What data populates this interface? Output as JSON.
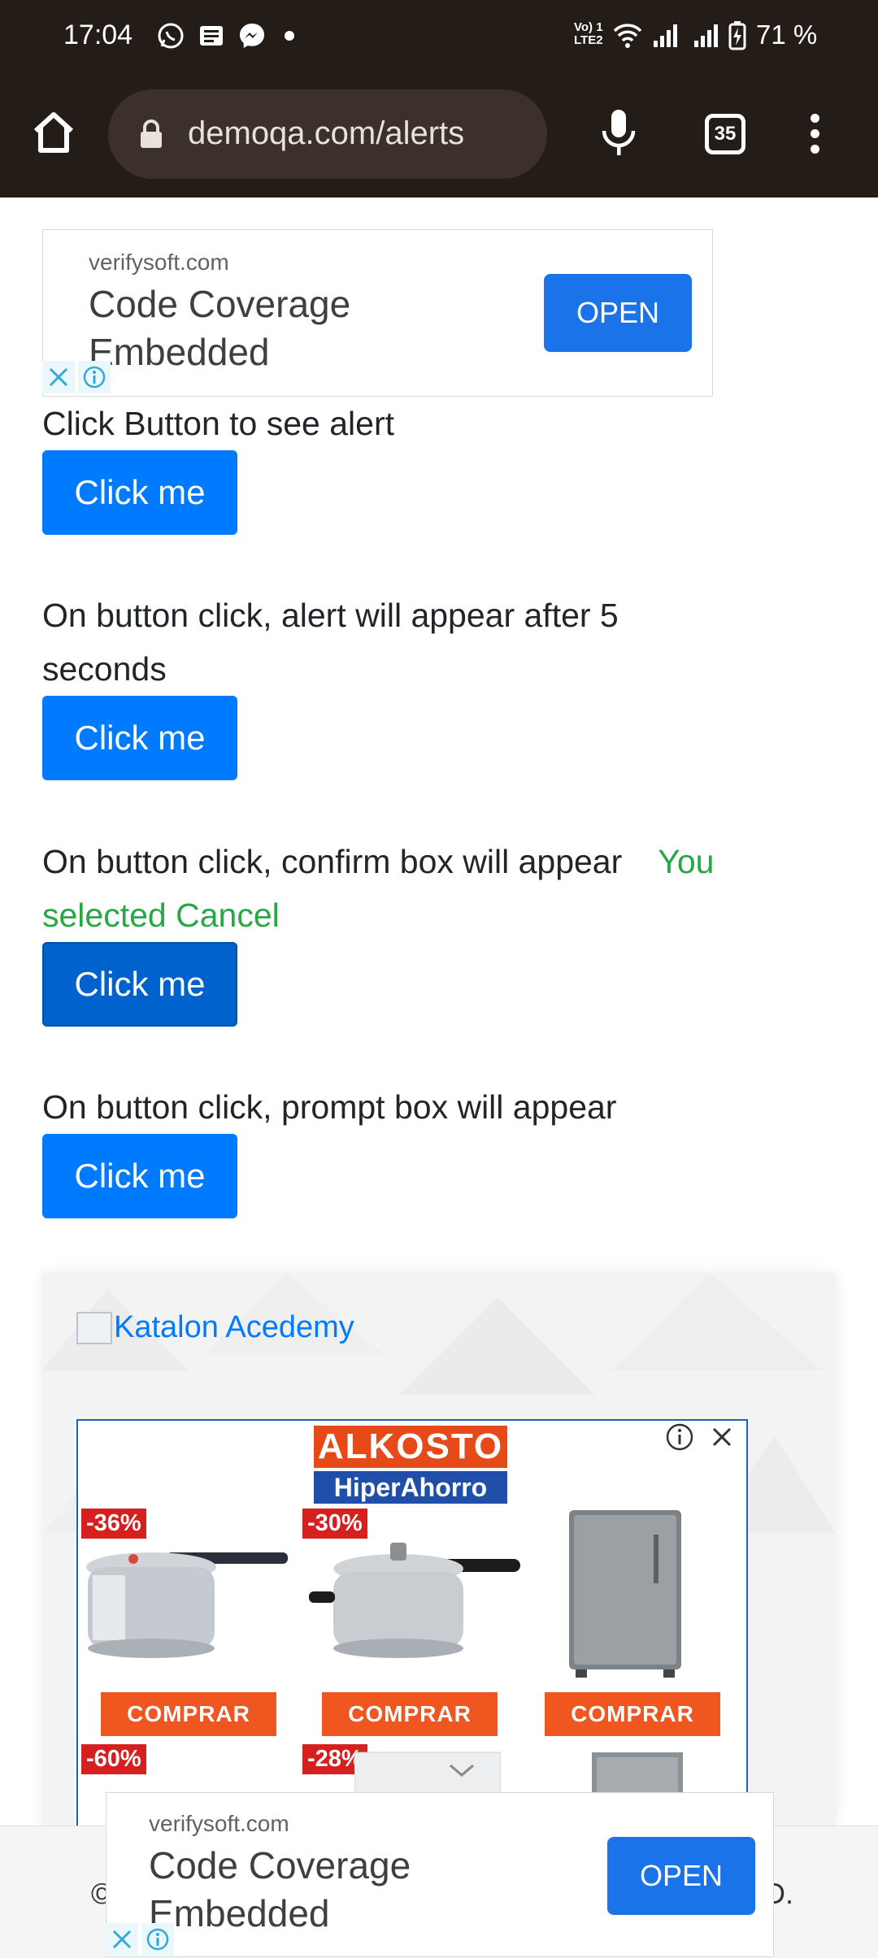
{
  "status_bar": {
    "time": "17:04",
    "notification_icons": [
      "whatsapp-icon",
      "news-icon",
      "messenger-icon",
      "dot-icon"
    ],
    "network_label_top": "Vo) 1",
    "network_label_bottom": "LTE2",
    "battery": "71 %"
  },
  "browser": {
    "url": "demoqa.com/alerts",
    "tab_count": "35"
  },
  "top_ad": {
    "domain": "verifysoft.com",
    "title": "Code Coverage Embedded",
    "cta": "OPEN"
  },
  "alerts": [
    {
      "description": "Click Button to see alert",
      "button": "Click me"
    },
    {
      "description": "On button click, alert will appear after 5 seconds",
      "button": "Click me"
    },
    {
      "description": "On button click, confirm box will appear",
      "result": "You selected Cancel",
      "button": "Click me"
    },
    {
      "description": "On button click, prompt box will appear",
      "button": "Click me"
    }
  ],
  "katalon": {
    "link_text": "Katalon Acedemy"
  },
  "alkosto_ad": {
    "logo_top": "ALKOSTO",
    "logo_bottom": "HiperAhorro",
    "products": [
      {
        "discount": "-36%",
        "cta": "COMPRAR"
      },
      {
        "discount": "-30%",
        "cta": "COMPRAR"
      },
      {
        "discount": "",
        "cta": "COMPRAR"
      }
    ],
    "second_row_discounts": [
      "-60%",
      "-28%"
    ]
  },
  "bottom_ad": {
    "domain": "verifysoft.com",
    "title": "Code Coverage Embedded",
    "cta": "OPEN"
  },
  "footer": {
    "left": "©",
    "right": "D."
  },
  "colors": {
    "primary_button": "#007bff",
    "success_text": "#28a745",
    "chrome_bg": "#231c17",
    "ad_cta": "#1a73e8"
  }
}
